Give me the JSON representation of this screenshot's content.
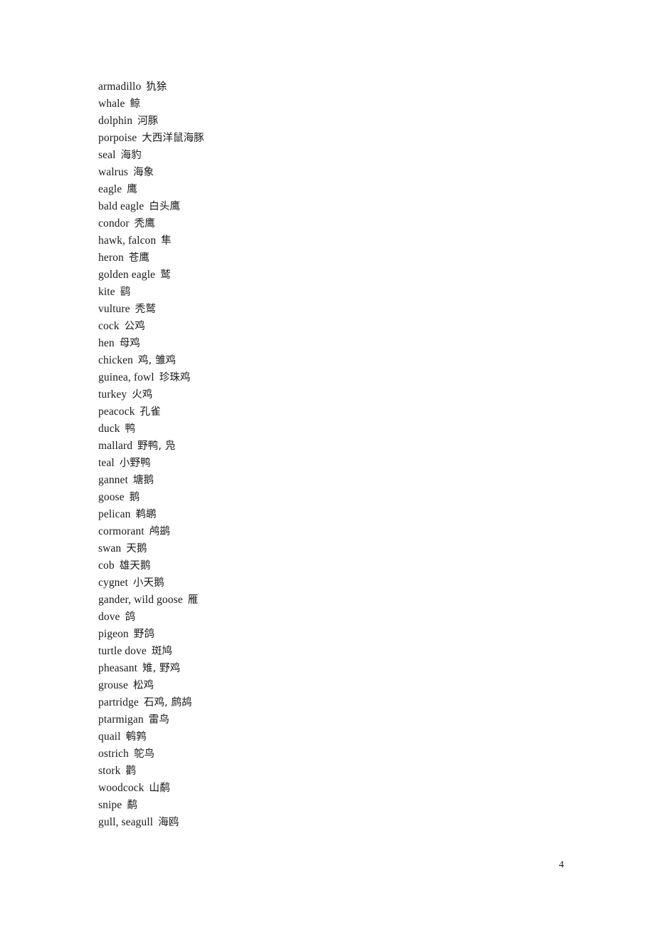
{
  "document": {
    "page_number": "4",
    "entries": [
      {
        "term": "armadillo",
        "gloss": "犰狳"
      },
      {
        "term": "whale",
        "gloss": "鲸"
      },
      {
        "term": "dolphin",
        "gloss": "河豚"
      },
      {
        "term": "porpoise",
        "gloss": "大西洋鼠海豚"
      },
      {
        "term": "seal",
        "gloss": "海豹"
      },
      {
        "term": "walrus",
        "gloss": "海象"
      },
      {
        "term": "eagle",
        "gloss": "鹰"
      },
      {
        "term": "bald eagle",
        "gloss": "白头鹰"
      },
      {
        "term": "condor",
        "gloss": "秃鹰"
      },
      {
        "term": "hawk, falcon",
        "gloss": "隼"
      },
      {
        "term": "heron",
        "gloss": "苍鹰"
      },
      {
        "term": "golden eagle",
        "gloss": "鹫"
      },
      {
        "term": "kite",
        "gloss": "鹞"
      },
      {
        "term": "vulture",
        "gloss": "秃鹫"
      },
      {
        "term": "cock",
        "gloss": "公鸡"
      },
      {
        "term": "hen",
        "gloss": "母鸡"
      },
      {
        "term": "chicken",
        "gloss": "鸡, 雏鸡"
      },
      {
        "term": "guinea, fowl",
        "gloss": "珍珠鸡"
      },
      {
        "term": "turkey",
        "gloss": "火鸡"
      },
      {
        "term": "peacock",
        "gloss": "孔雀"
      },
      {
        "term": "duck",
        "gloss": "鸭"
      },
      {
        "term": "mallard",
        "gloss": "野鸭, 凫"
      },
      {
        "term": "teal",
        "gloss": "小野鸭"
      },
      {
        "term": "gannet",
        "gloss": "塘鹅"
      },
      {
        "term": "goose",
        "gloss": "鹅"
      },
      {
        "term": "pelican",
        "gloss": "鹈鹕"
      },
      {
        "term": "cormorant",
        "gloss": "鸬鹚"
      },
      {
        "term": "swan",
        "gloss": "天鹅"
      },
      {
        "term": "cob",
        "gloss": "雄天鹅"
      },
      {
        "term": "cygnet",
        "gloss": "小天鹅"
      },
      {
        "term": "gander, wild goose",
        "gloss": "雁"
      },
      {
        "term": "dove",
        "gloss": "鸽"
      },
      {
        "term": "pigeon",
        "gloss": "野鸽"
      },
      {
        "term": "turtle dove",
        "gloss": "斑鸠"
      },
      {
        "term": "pheasant",
        "gloss": "雉, 野鸡"
      },
      {
        "term": "grouse",
        "gloss": "松鸡"
      },
      {
        "term": "partridge",
        "gloss": "石鸡, 鹧鸪"
      },
      {
        "term": "ptarmigan",
        "gloss": "雷鸟"
      },
      {
        "term": "quail",
        "gloss": "鹌鹑"
      },
      {
        "term": "ostrich",
        "gloss": "鸵鸟"
      },
      {
        "term": "stork",
        "gloss": "鹳"
      },
      {
        "term": "woodcock",
        "gloss": "山鹬"
      },
      {
        "term": "snipe",
        "gloss": "鹬"
      },
      {
        "term": "gull, seagull",
        "gloss": "海鸥"
      }
    ]
  }
}
